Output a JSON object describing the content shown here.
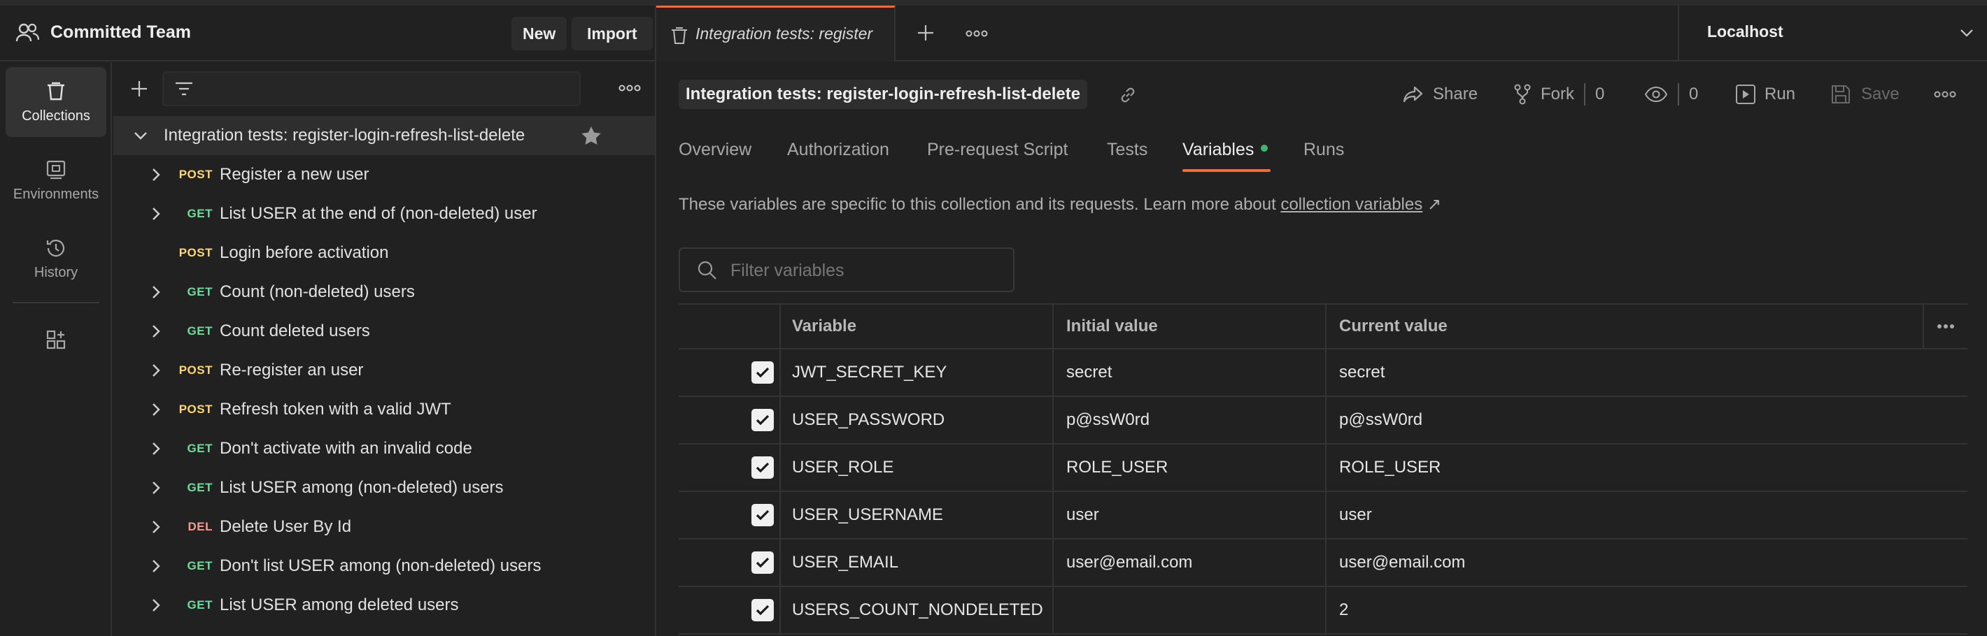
{
  "workspace": {
    "name": "Committed Team",
    "new_label": "New",
    "import_label": "Import"
  },
  "rail": {
    "items": [
      {
        "label": "Collections",
        "icon": "trash-can-icon",
        "active": true
      },
      {
        "label": "Environments",
        "icon": "environment-icon",
        "active": false
      },
      {
        "label": "History",
        "icon": "history-icon",
        "active": false
      }
    ]
  },
  "tree": {
    "collection": "Integration tests: register-login-refresh-list-delete",
    "requests": [
      {
        "method": "POST",
        "name": "Register a new user",
        "expandable": true
      },
      {
        "method": "GET",
        "name": "List USER at the end of (non-deleted) user",
        "expandable": true
      },
      {
        "method": "POST",
        "name": "Login before activation",
        "expandable": false
      },
      {
        "method": "GET",
        "name": "Count (non-deleted) users",
        "expandable": true
      },
      {
        "method": "GET",
        "name": "Count deleted users",
        "expandable": true
      },
      {
        "method": "POST",
        "name": "Re-register an user",
        "expandable": true
      },
      {
        "method": "POST",
        "name": "Refresh token with a valid JWT",
        "expandable": true
      },
      {
        "method": "GET",
        "name": "Don't activate with an invalid code",
        "expandable": true
      },
      {
        "method": "GET",
        "name": "List USER among (non-deleted) users",
        "expandable": true
      },
      {
        "method": "DEL",
        "name": "Delete User By Id",
        "expandable": true
      },
      {
        "method": "GET",
        "name": "Don't list USER among (non-deleted) users",
        "expandable": true
      },
      {
        "method": "GET",
        "name": "List USER among deleted users",
        "expandable": true
      }
    ]
  },
  "tabbar": {
    "active_tab": "Integration tests: register",
    "environment": "Localhost"
  },
  "collection_header": {
    "title": "Integration tests: register-login-refresh-list-delete",
    "share_label": "Share",
    "fork_label": "Fork",
    "fork_count": "0",
    "watch_count": "0",
    "run_label": "Run",
    "save_label": "Save"
  },
  "subtabs": [
    {
      "label": "Overview",
      "active": false
    },
    {
      "label": "Authorization",
      "active": false
    },
    {
      "label": "Pre-request Script",
      "active": false
    },
    {
      "label": "Tests",
      "active": false
    },
    {
      "label": "Variables",
      "active": true
    },
    {
      "label": "Runs",
      "active": false
    }
  ],
  "info": {
    "text": "These variables are specific to this collection and its requests. Learn more about ",
    "link": "collection variables",
    "arrow": "↗"
  },
  "filter": {
    "placeholder": "Filter variables"
  },
  "table": {
    "headers": {
      "variable": "Variable",
      "initial": "Initial value",
      "current": "Current value"
    },
    "rows": [
      {
        "checked": true,
        "variable": "JWT_SECRET_KEY",
        "initial": "secret",
        "current": "secret"
      },
      {
        "checked": true,
        "variable": "USER_PASSWORD",
        "initial": "p@ssW0rd",
        "current": "p@ssW0rd"
      },
      {
        "checked": true,
        "variable": "USER_ROLE",
        "initial": "ROLE_USER",
        "current": "ROLE_USER"
      },
      {
        "checked": true,
        "variable": "USER_USERNAME",
        "initial": "user",
        "current": "user"
      },
      {
        "checked": true,
        "variable": "USER_EMAIL",
        "initial": "user@email.com",
        "current": "user@email.com"
      },
      {
        "checked": true,
        "variable": "USERS_COUNT_NONDELETED",
        "initial": "",
        "current": "2"
      }
    ]
  },
  "colors": {
    "accent": "#f26b3a",
    "post": "#ffd76a",
    "get": "#6bdd9a",
    "del": "#f79a8e",
    "dot": "#3fb56e"
  }
}
